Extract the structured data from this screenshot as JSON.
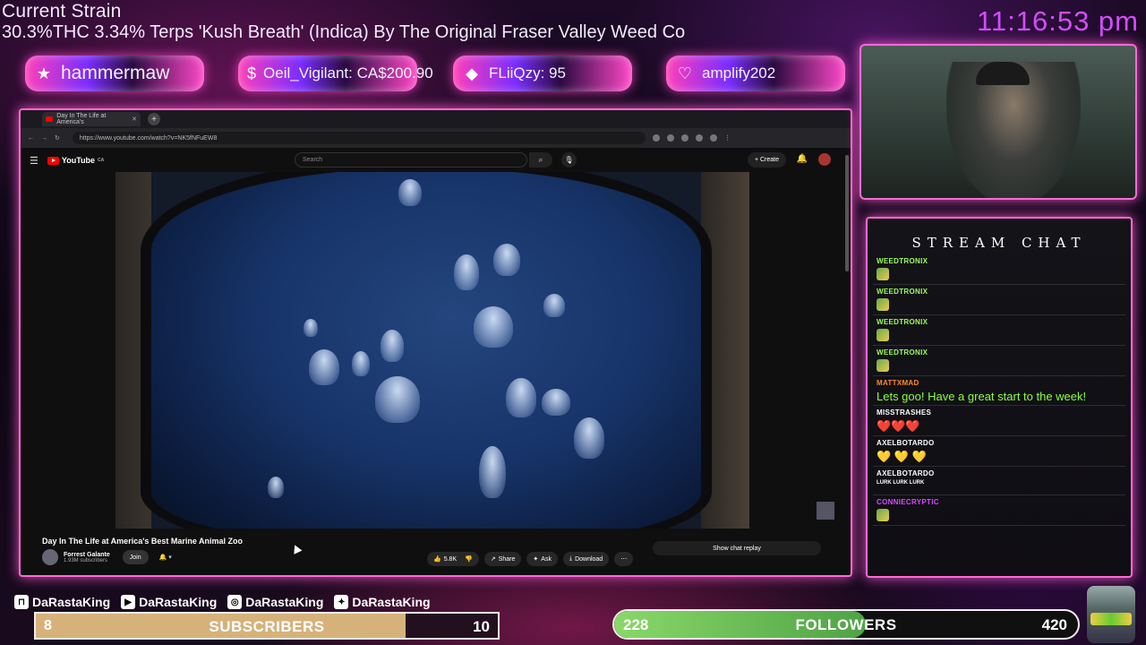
{
  "overlay": {
    "strain_title": "Current Strain",
    "strain_desc": "30.3%THC 3.34% Terps 'Kush Breath' (Indica) By The Original Fraser Valley Weed Co",
    "clock": "11:16:53 pm"
  },
  "alerts": [
    {
      "icon": "star-icon",
      "text": "hammermaw"
    },
    {
      "icon": "dollar-icon",
      "text": "Oeil_Vigilant: CA$200.90"
    },
    {
      "icon": "diamond-icon",
      "text": "FLiiQzy: 95"
    },
    {
      "icon": "heart-icon",
      "text": "amplify202"
    }
  ],
  "browser": {
    "tab_title": "Day In The Life at America's",
    "url": "https://www.youtube.com/watch?v=NK5fNFuEW8",
    "search_placeholder": "Search",
    "create_label": "Create",
    "logo": "YouTube",
    "logo_region": "CA"
  },
  "video": {
    "title": "Day In The Life at America's Best Marine Animal Zoo",
    "channel": "Forrest Galante",
    "subscribers": "1.93M subscribers",
    "join": "Join",
    "likes": "5.8K",
    "share": "Share",
    "ask": "Ask",
    "download": "Download",
    "chat_replay": "Show chat replay"
  },
  "chat": {
    "header": "STREAM CHAT",
    "messages": [
      {
        "user": "WEEDTRONIX",
        "color": "#9aff5a",
        "text": ""
      },
      {
        "user": "WEEDTRONIX",
        "color": "#9aff5a",
        "text": ""
      },
      {
        "user": "WEEDTRONIX",
        "color": "#9aff5a",
        "text": ""
      },
      {
        "user": "WEEDTRONIX",
        "color": "#9aff5a",
        "text": ""
      },
      {
        "user": "MATTXMAD",
        "color": "#ff8a2a",
        "text": "Lets goo! Have a great start to the week!"
      },
      {
        "user": "MISSTRASHES",
        "color": "#ffffff",
        "text": "❤️❤️❤️"
      },
      {
        "user": "AXELBOTARDO",
        "color": "#ffffff",
        "text": "💛 💛 💛"
      },
      {
        "user": "AXELBOTARDO",
        "color": "#ffffff",
        "text": "LURK LURK LURK"
      },
      {
        "user": "CONNIECRYPTIC",
        "color": "#d54bff",
        "text": ""
      }
    ]
  },
  "socials": [
    {
      "icon": "twitch-icon",
      "glyph": "⊓",
      "handle": "DaRastaKing"
    },
    {
      "icon": "youtube-icon",
      "glyph": "▶",
      "handle": "DaRastaKing"
    },
    {
      "icon": "instagram-icon",
      "glyph": "◎",
      "handle": "DaRastaKing"
    },
    {
      "icon": "twitter-icon",
      "glyph": "✦",
      "handle": "DaRastaKing"
    }
  ],
  "goals": {
    "subscribers": {
      "current": "8",
      "label": "SUBSCRIBERS",
      "goal": "10",
      "progress": 0.8
    },
    "followers": {
      "current": "228",
      "label": "FOLLOWERS",
      "goal": "420",
      "progress": 0.5428
    }
  }
}
